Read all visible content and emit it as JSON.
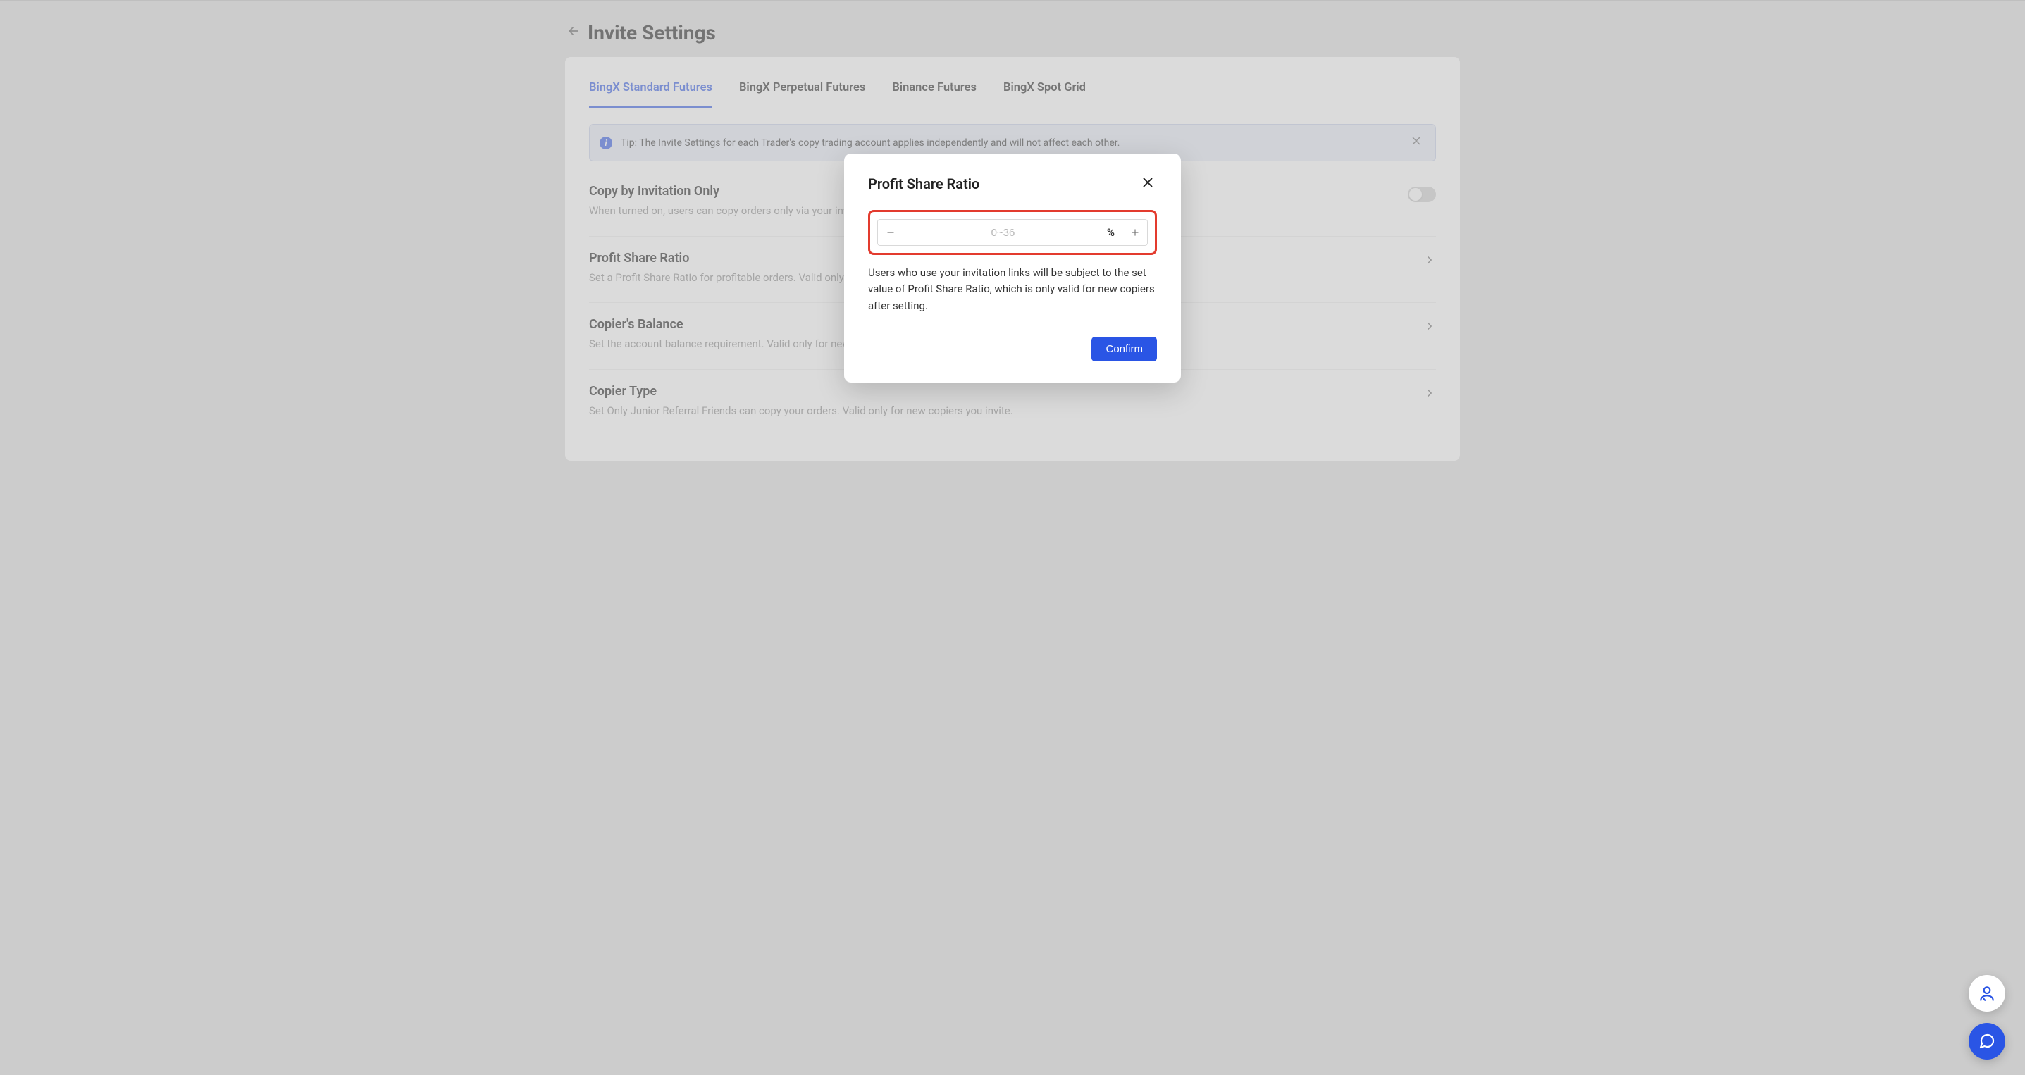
{
  "header": {
    "title": "Invite Settings"
  },
  "tabs": [
    {
      "label": "BingX Standard Futures",
      "active": true
    },
    {
      "label": "BingX Perpetual Futures",
      "active": false
    },
    {
      "label": "Binance Futures",
      "active": false
    },
    {
      "label": "BingX Spot Grid",
      "active": false
    }
  ],
  "tip": {
    "text": "Tip: The Invite Settings for each Trader's copy trading account applies independently and will not affect each other."
  },
  "settings": {
    "copy_by_invite": {
      "title": "Copy by Invitation Only",
      "desc": "When turned on, users can copy orders only via your invitation links.",
      "toggle_on": false
    },
    "profit_share": {
      "title": "Profit Share Ratio",
      "desc": "Set a Profit Share Ratio for profitable orders. Valid only for new copiers you invite."
    },
    "copier_balance": {
      "title": "Copier's Balance",
      "desc": "Set the account balance requirement. Valid only for new copiers you invite."
    },
    "copier_type": {
      "title": "Copier Type",
      "desc": "Set Only Junior Referral Friends can copy your orders. Valid only for new copiers you invite."
    }
  },
  "modal": {
    "title": "Profit Share Ratio",
    "input_placeholder": "0~36",
    "input_value": "",
    "unit": "%",
    "desc": "Users who use your invitation links will be subject to the set value of Profit Share Ratio, which is only valid for new copiers after setting.",
    "confirm_label": "Confirm"
  },
  "icons": {
    "back": "arrow-left",
    "info": "info",
    "close": "x",
    "chevron": "chevron-right",
    "support_person": "person",
    "chat": "chat"
  }
}
